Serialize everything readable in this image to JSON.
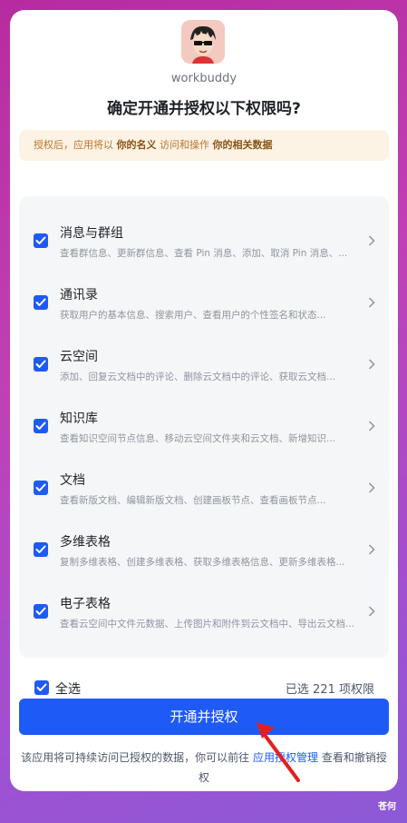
{
  "app": {
    "name": "workbuddy"
  },
  "dialog": {
    "title": "确定开通并授权以下权限吗?"
  },
  "notice": {
    "part1": "授权后，应用将以 ",
    "strong1": "你的名义",
    "part2": " 访问和操作 ",
    "strong2": "你的相关数据"
  },
  "permissions": [
    {
      "name": "消息与群组",
      "desc": "查看群信息、更新群信息、查看 Pin 消息、添加、取消 Pin 消息、...",
      "checked": true
    },
    {
      "name": "通讯录",
      "desc": "获取用户的基本信息、搜索用户、查看用户的个性签名和状态...",
      "checked": true
    },
    {
      "name": "云空间",
      "desc": "添加、回复云文档中的评论、删除云文档中的评论、获取云文档...",
      "checked": true
    },
    {
      "name": "知识库",
      "desc": "查看知识空间节点信息、移动云空间文件夹和云文档、新增知识...",
      "checked": true
    },
    {
      "name": "文档",
      "desc": "查看新版文档、编辑新版文档、创建画板节点、查看画板节点...",
      "checked": true
    },
    {
      "name": "多维表格",
      "desc": "复制多维表格、创建多维表格、获取多维表格信息、更新多维表格...",
      "checked": true
    },
    {
      "name": "电子表格",
      "desc": "查看云空间中文件元数据、上传图片和附件到云文档中、导出云文档...",
      "checked": true
    }
  ],
  "select_all": {
    "label": "全选",
    "checked": true
  },
  "selected_count": {
    "text": "已选 221 项权限"
  },
  "primary_button": {
    "label": "开通并授权"
  },
  "footer": {
    "text1": "该应用将可持续访问已授权的数据，你可以前往 ",
    "link": "应用授权管理",
    "text2": " 查看和撤销授权"
  },
  "watermark": "苍何",
  "colors": {
    "accent": "#1e5af5",
    "notice_bg": "#fdf3e4",
    "notice_text": "#b9742b",
    "annotation_arrow": "#e02020"
  }
}
